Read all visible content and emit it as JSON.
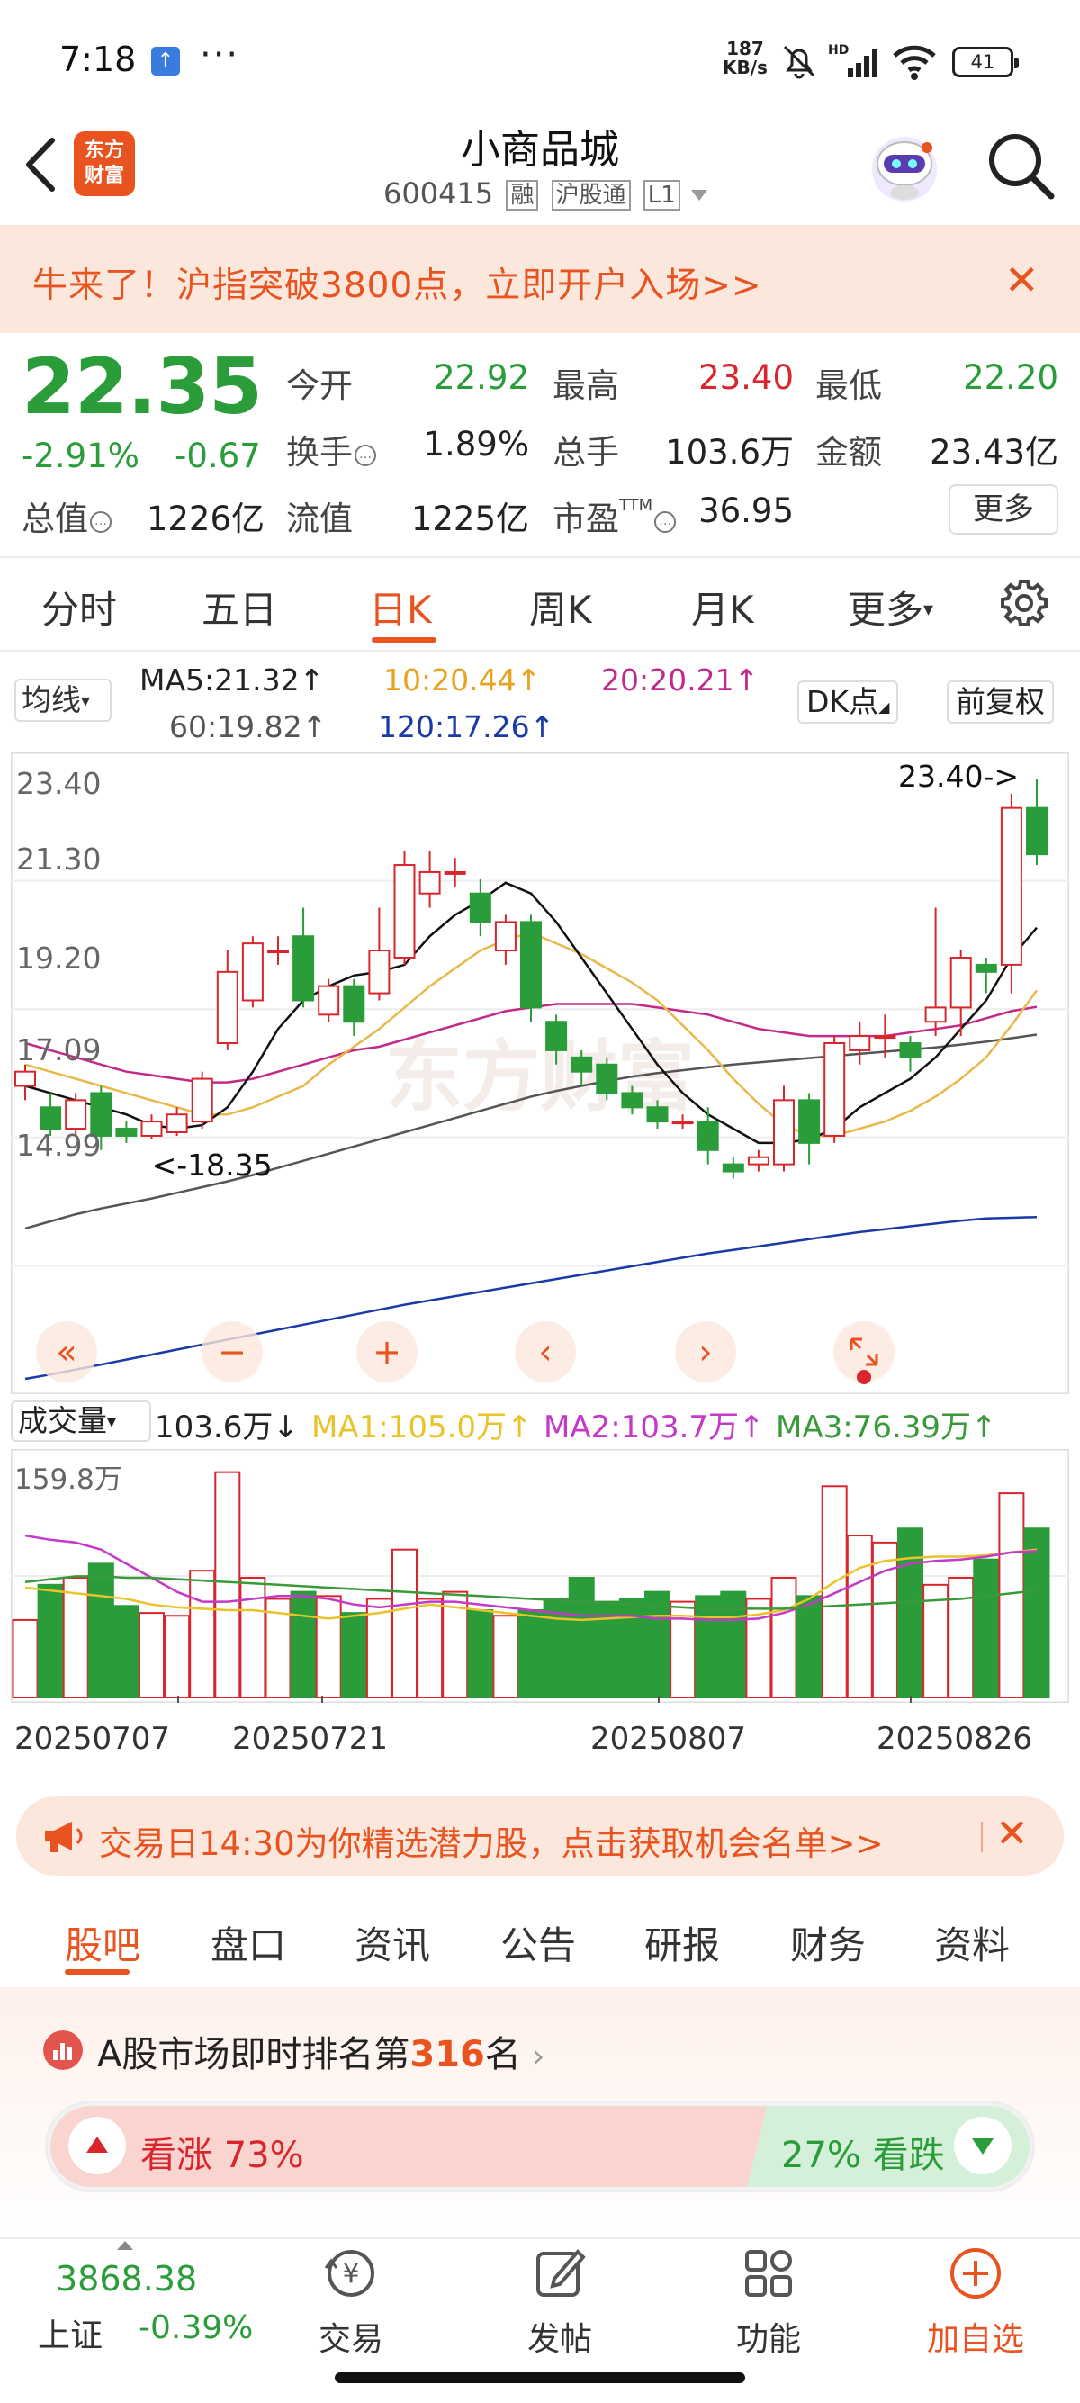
{
  "status_bar": {
    "time": "7:18",
    "dots": "···",
    "speed_value": "187",
    "speed_unit": "KB/s",
    "battery": "41"
  },
  "header": {
    "logo_line1": "东方",
    "logo_line2": "财富",
    "title": "小商品城",
    "code": "600415",
    "tags": [
      "融",
      "沪股通",
      "L1"
    ]
  },
  "banner": {
    "text": "牛来了！沪指突破3800点，立即开户入场>>"
  },
  "quote": {
    "price": "22.35",
    "pct": "-2.91%",
    "change": "-0.67",
    "items": [
      {
        "label": "今开",
        "value": "22.92"
      },
      {
        "label": "最高",
        "value": "23.40"
      },
      {
        "label": "最低",
        "value": "22.20"
      },
      {
        "label": "换手",
        "value": "1.89%"
      },
      {
        "label": "总手",
        "value": "103.6万"
      },
      {
        "label": "金额",
        "value": "23.43亿"
      },
      {
        "label": "总值",
        "value": "1226亿"
      },
      {
        "label": "流值",
        "value": "1225亿"
      },
      {
        "label": "市盈",
        "sup": "TTM",
        "value": "36.95"
      }
    ],
    "more": "更多"
  },
  "chart_tabs": [
    "分时",
    "五日",
    "日K",
    "周K",
    "月K",
    "更多"
  ],
  "chart_tab_active": "日K",
  "ma_bar": {
    "selector": "均线",
    "ma5": "MA5:21.32↑",
    "ma10": "10:20.44↑",
    "ma20": "20:20.21↑",
    "ma60": "60:19.82↑",
    "ma120": "120:17.26↑",
    "dk": "DK点",
    "fq": "前复权"
  },
  "chart_data": {
    "type": "candlestick",
    "y_axis_labels": [
      "23.40",
      "21.30",
      "19.20",
      "17.09",
      "14.99"
    ],
    "ylim": [
      14.99,
      23.4
    ],
    "max_label": "23.40->",
    "min_label": "<-18.35",
    "watermark": "东方财富",
    "candles": [
      {
        "o": 19.1,
        "c": 19.3,
        "h": 19.4,
        "l": 18.9
      },
      {
        "o": 18.8,
        "c": 18.5,
        "h": 19.0,
        "l": 18.4
      },
      {
        "o": 18.5,
        "c": 18.9,
        "h": 19.0,
        "l": 18.4
      },
      {
        "o": 19.0,
        "c": 18.4,
        "h": 19.1,
        "l": 18.2
      },
      {
        "o": 18.5,
        "c": 18.4,
        "h": 18.6,
        "l": 18.3
      },
      {
        "o": 18.4,
        "c": 18.6,
        "h": 18.7,
        "l": 18.35
      },
      {
        "o": 18.45,
        "c": 18.7,
        "h": 18.8,
        "l": 18.4
      },
      {
        "o": 18.6,
        "c": 19.2,
        "h": 19.3,
        "l": 18.5
      },
      {
        "o": 19.7,
        "c": 20.7,
        "h": 21.0,
        "l": 19.6
      },
      {
        "o": 20.3,
        "c": 21.1,
        "h": 21.2,
        "l": 20.2
      },
      {
        "o": 21.0,
        "c": 21.0,
        "h": 21.2,
        "l": 20.8
      },
      {
        "o": 21.2,
        "c": 20.3,
        "h": 21.6,
        "l": 20.2
      },
      {
        "o": 20.1,
        "c": 20.5,
        "h": 20.6,
        "l": 20.0
      },
      {
        "o": 20.5,
        "c": 20.0,
        "h": 20.6,
        "l": 19.8
      },
      {
        "o": 20.4,
        "c": 21.0,
        "h": 21.6,
        "l": 20.3
      },
      {
        "o": 20.9,
        "c": 22.2,
        "h": 22.4,
        "l": 20.8
      },
      {
        "o": 21.8,
        "c": 22.1,
        "h": 22.4,
        "l": 21.6
      },
      {
        "o": 22.1,
        "c": 22.1,
        "h": 22.3,
        "l": 21.9
      },
      {
        "o": 21.8,
        "c": 21.4,
        "h": 22.0,
        "l": 21.2
      },
      {
        "o": 21.0,
        "c": 21.4,
        "h": 21.5,
        "l": 20.8
      },
      {
        "o": 21.4,
        "c": 20.2,
        "h": 21.5,
        "l": 20.0
      },
      {
        "o": 20.0,
        "c": 19.6,
        "h": 20.1,
        "l": 19.4
      },
      {
        "o": 19.5,
        "c": 19.3,
        "h": 19.6,
        "l": 19.1
      },
      {
        "o": 19.4,
        "c": 19.0,
        "h": 19.5,
        "l": 18.9
      },
      {
        "o": 19.0,
        "c": 18.8,
        "h": 19.1,
        "l": 18.7
      },
      {
        "o": 18.8,
        "c": 18.6,
        "h": 18.9,
        "l": 18.5
      },
      {
        "o": 18.6,
        "c": 18.6,
        "h": 18.7,
        "l": 18.5
      },
      {
        "o": 18.6,
        "c": 18.2,
        "h": 18.8,
        "l": 18.0
      },
      {
        "o": 18.0,
        "c": 17.9,
        "h": 18.1,
        "l": 17.8
      },
      {
        "o": 18.0,
        "c": 18.1,
        "h": 18.2,
        "l": 17.9
      },
      {
        "o": 18.0,
        "c": 18.9,
        "h": 19.1,
        "l": 17.9
      },
      {
        "o": 18.9,
        "c": 18.3,
        "h": 19.0,
        "l": 18.0
      },
      {
        "o": 18.4,
        "c": 19.7,
        "h": 19.8,
        "l": 18.3
      },
      {
        "o": 19.6,
        "c": 19.8,
        "h": 20.0,
        "l": 19.4
      },
      {
        "o": 19.8,
        "c": 19.8,
        "h": 20.1,
        "l": 19.5
      },
      {
        "o": 19.7,
        "c": 19.5,
        "h": 19.8,
        "l": 19.3
      },
      {
        "o": 20.0,
        "c": 20.2,
        "h": 21.6,
        "l": 19.8
      },
      {
        "o": 20.2,
        "c": 20.9,
        "h": 21.0,
        "l": 19.8
      },
      {
        "o": 20.8,
        "c": 20.7,
        "h": 20.9,
        "l": 20.4
      },
      {
        "o": 20.8,
        "c": 23.0,
        "h": 23.2,
        "l": 20.4
      },
      {
        "o": 23.0,
        "c": 22.35,
        "h": 23.4,
        "l": 22.2
      }
    ],
    "ma_lines": {
      "ma5": [
        19.1,
        19.0,
        18.9,
        18.8,
        18.7,
        18.55,
        18.5,
        18.55,
        18.8,
        19.3,
        19.9,
        20.3,
        20.5,
        20.65,
        20.7,
        20.8,
        21.2,
        21.5,
        21.7,
        21.95,
        21.8,
        21.4,
        20.9,
        20.4,
        19.9,
        19.4,
        19.0,
        18.7,
        18.5,
        18.3,
        18.3,
        18.35,
        18.5,
        18.8,
        19.0,
        19.2,
        19.5,
        19.9,
        20.3,
        20.9,
        21.32
      ],
      "ma10": [
        19.4,
        19.3,
        19.2,
        19.1,
        19.0,
        18.9,
        18.8,
        18.7,
        18.7,
        18.8,
        18.95,
        19.1,
        19.4,
        19.65,
        19.9,
        20.2,
        20.5,
        20.75,
        21.0,
        21.15,
        21.25,
        21.1,
        20.95,
        20.75,
        20.55,
        20.3,
        19.95,
        19.6,
        19.2,
        18.85,
        18.55,
        18.4,
        18.4,
        18.5,
        18.6,
        18.75,
        18.95,
        19.2,
        19.5,
        19.95,
        20.44
      ],
      "ma20": [
        19.7,
        19.6,
        19.5,
        19.4,
        19.3,
        19.25,
        19.2,
        19.15,
        19.15,
        19.2,
        19.3,
        19.4,
        19.5,
        19.6,
        19.65,
        19.75,
        19.85,
        19.95,
        20.05,
        20.15,
        20.2,
        20.25,
        20.25,
        20.25,
        20.25,
        20.2,
        20.15,
        20.1,
        20.0,
        19.9,
        19.85,
        19.8,
        19.8,
        19.8,
        19.8,
        19.85,
        19.9,
        19.95,
        20.05,
        20.15,
        20.21
      ],
      "ma60": [
        17.1,
        17.2,
        17.3,
        17.38,
        17.45,
        17.52,
        17.6,
        17.68,
        17.76,
        17.85,
        17.95,
        18.05,
        18.15,
        18.25,
        18.35,
        18.45,
        18.55,
        18.65,
        18.75,
        18.85,
        18.95,
        19.03,
        19.1,
        19.17,
        19.23,
        19.28,
        19.32,
        19.36,
        19.4,
        19.43,
        19.46,
        19.49,
        19.52,
        19.55,
        19.58,
        19.61,
        19.64,
        19.68,
        19.72,
        19.77,
        19.82
      ],
      "ma120": [
        14.99,
        15.05,
        15.12,
        15.19,
        15.26,
        15.33,
        15.4,
        15.47,
        15.54,
        15.61,
        15.68,
        15.75,
        15.82,
        15.89,
        15.96,
        16.03,
        16.09,
        16.15,
        16.21,
        16.27,
        16.33,
        16.39,
        16.45,
        16.51,
        16.57,
        16.63,
        16.69,
        16.75,
        16.8,
        16.85,
        16.9,
        16.95,
        17.0,
        17.05,
        17.09,
        17.13,
        17.17,
        17.21,
        17.24,
        17.25,
        17.26
      ]
    },
    "volumes": [
      55,
      80,
      85,
      95,
      65,
      60,
      58,
      90,
      160,
      85,
      70,
      75,
      72,
      60,
      70,
      105,
      70,
      75,
      62,
      58,
      62,
      70,
      85,
      68,
      70,
      75,
      68,
      72,
      75,
      70,
      85,
      72,
      150,
      115,
      110,
      120,
      80,
      85,
      98,
      145,
      120
    ],
    "vol_max_label": "159.8万",
    "vol_ma1": [
      78,
      76,
      74,
      72,
      70,
      66,
      64,
      63,
      62,
      62,
      60,
      58,
      56,
      58,
      60,
      63,
      66,
      64,
      62,
      60,
      58,
      56,
      55,
      56,
      57,
      58,
      58,
      57,
      57,
      59,
      62,
      70,
      82,
      92,
      97,
      99,
      100,
      100,
      101,
      103,
      105
    ],
    "vol_ma2": [
      115,
      112,
      110,
      105,
      95,
      85,
      75,
      68,
      68,
      70,
      72,
      72,
      70,
      66,
      64,
      66,
      68,
      68,
      66,
      64,
      62,
      60,
      58,
      58,
      58,
      56,
      56,
      55,
      55,
      56,
      60,
      66,
      74,
      82,
      90,
      95,
      97,
      98,
      100,
      103,
      104
    ],
    "vol_ma3": [
      82,
      84,
      86,
      86,
      85,
      85,
      84,
      83,
      82,
      81,
      80,
      79,
      78,
      77,
      76,
      75,
      74,
      73,
      72,
      71,
      70,
      69,
      68,
      67,
      66,
      65,
      64,
      63,
      63,
      63,
      63,
      64,
      65,
      66,
      67,
      68,
      69,
      70,
      72,
      74,
      76
    ],
    "x_labels": [
      "20250707",
      "20250721",
      "20250807",
      "20250826"
    ]
  },
  "volume_bar": {
    "selector": "成交量",
    "value": "103.6万↓",
    "ma1": "MA1:105.0万↑",
    "ma2": "MA2:103.7万↑",
    "ma3": "MA3:76.39万↑"
  },
  "chart_controls": [
    "«",
    "−",
    "+",
    "‹",
    "›"
  ],
  "notice": {
    "text": "交易日14:30为你精选潜力股，点击获取机会名单>>"
  },
  "bottom_tabs": [
    "股吧",
    "盘口",
    "资讯",
    "公告",
    "研报",
    "财务",
    "资料"
  ],
  "bottom_tab_active": "股吧",
  "rank": {
    "prefix": "A股市场即时排名第",
    "rank": "316",
    "suffix": "名"
  },
  "vote": {
    "up": "看涨 73%",
    "down": "27% 看跌"
  },
  "bottom_nav": {
    "index_value": "3868.38",
    "index_name": "上证",
    "index_pct": "-0.39%",
    "items": [
      "交易",
      "发帖",
      "功能",
      "加自选"
    ]
  },
  "colors": {
    "accent": "#e8531f",
    "up": "#d9262c",
    "down": "#2a9d3a"
  }
}
